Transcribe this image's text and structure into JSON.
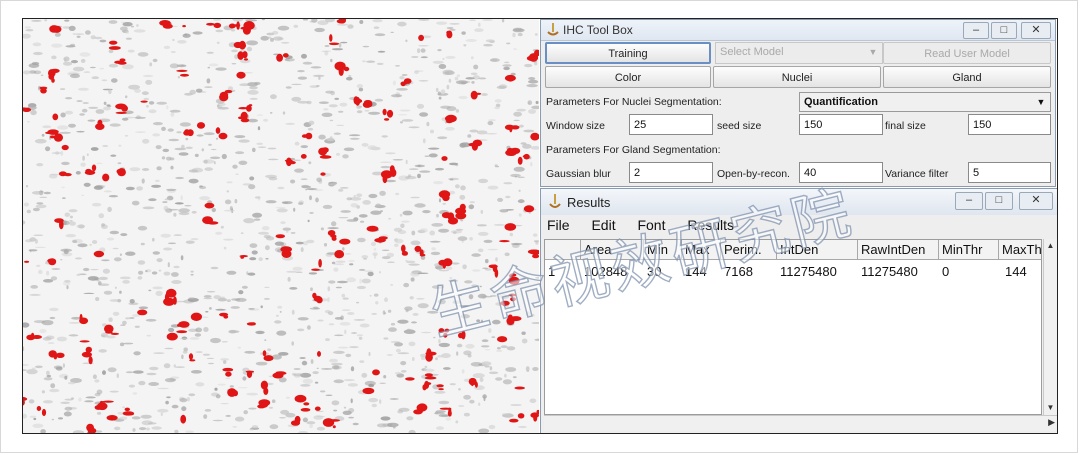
{
  "toolbox": {
    "title": "IHC Tool Box",
    "buttons": {
      "training": "Training",
      "select_model": "Select Model",
      "read_user_model": "Read User Model",
      "color": "Color",
      "nuclei": "Nuclei",
      "gland": "Gland"
    },
    "nuclei_section": "Parameters For Nuclei Segmentation:",
    "quantification": "Quantification",
    "window_size_label": "Window size",
    "window_size_value": "25",
    "seed_size_label": "seed size",
    "seed_size_value": "150",
    "final_size_label": "final size",
    "final_size_value": "150",
    "gland_section": "Parameters For Gland Segmentation:",
    "gaussian_blur_label": "Gaussian blur",
    "gaussian_blur_value": "2",
    "open_by_recon_label": "Open-by-recon.",
    "open_by_recon_value": "40",
    "variance_filter_label": "Variance filter",
    "variance_filter_value": "5"
  },
  "results": {
    "title": "Results",
    "menu": [
      "File",
      "Edit",
      "Font",
      "Results"
    ],
    "columns": [
      "",
      "Area",
      "Min",
      "Max",
      "Perim.",
      "IntDen",
      "RawIntDen",
      "MinThr",
      "MaxTh"
    ],
    "row": [
      "1",
      "102848",
      "30",
      "144",
      "7168",
      "11275480",
      "11275480",
      "0",
      "144"
    ]
  },
  "watermark": "生命视效研究院",
  "colors": {
    "stain": "#e01515",
    "tissue": "#b8b8b8",
    "window_border": "#8a9bb0"
  }
}
